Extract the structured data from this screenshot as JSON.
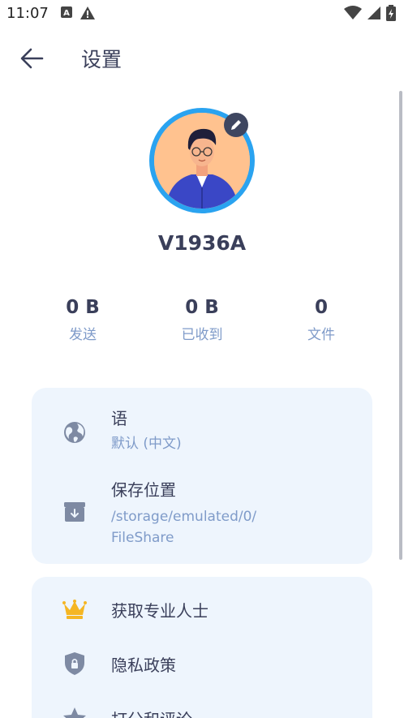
{
  "status_bar": {
    "time": "11:07"
  },
  "header": {
    "title": "设置",
    "back_icon": "arrow-left-icon"
  },
  "profile": {
    "username": "V1936A",
    "avatar_icon": "user-avatar",
    "edit_icon": "pencil-icon",
    "ring_color": "#2aa3f0"
  },
  "stats": [
    {
      "value": "0 B",
      "label": "发送"
    },
    {
      "value": "0 B",
      "label": "已收到"
    },
    {
      "value": "0",
      "label": "文件"
    }
  ],
  "settings_card": {
    "language": {
      "title": "语",
      "value": "默认 (中文)",
      "icon": "globe-icon"
    },
    "save_location": {
      "title": "保存位置",
      "value_line1": "/storage/emulated/0/",
      "value_line2": "FileShare",
      "icon": "download-box-icon"
    }
  },
  "more_card": {
    "items": [
      {
        "title": "获取专业人士",
        "icon": "crown-icon"
      },
      {
        "title": "隐私政策",
        "icon": "shield-lock-icon"
      },
      {
        "title": "打分和评论",
        "icon": "star-icon"
      }
    ]
  },
  "colors": {
    "accent_blue": "#2aa3f0",
    "muted_text": "#7f9bc9",
    "card_bg": "#eef5fd",
    "crown_gold": "#f5b623"
  }
}
